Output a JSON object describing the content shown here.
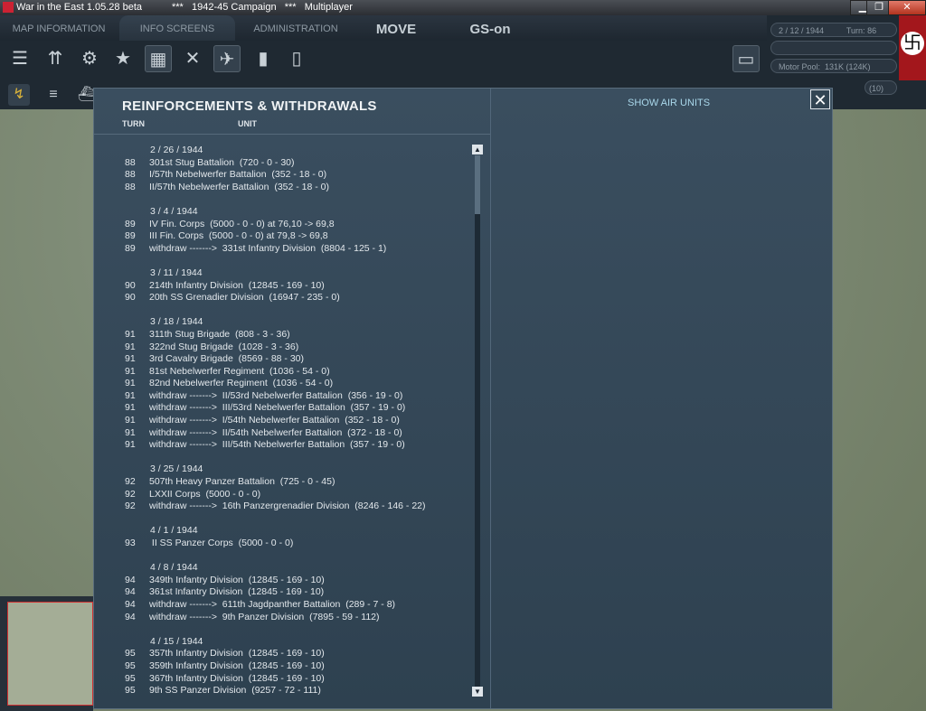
{
  "window": {
    "title": "War in the East 1.05.28 beta",
    "campaign": "***   1942-45 Campaign   ***   Multiplayer",
    "minimize": "▁",
    "restore": "❐",
    "close": "✕"
  },
  "tabs": {
    "map_information": "MAP INFORMATION",
    "info_screens": "INFO SCREENS",
    "administration": "ADMINISTRATION",
    "move": "MOVE",
    "gs_on": "GS-on"
  },
  "status": {
    "date": "2 / 12 / 1944",
    "turn": "Turn: 86",
    "motor_pool": "Motor Pool:  131K (124K)",
    "counter": "(10)"
  },
  "dialog": {
    "title": "REINFORCEMENTS & WITHDRAWALS",
    "col_turn": "TURN",
    "col_unit": "UNIT",
    "show_air_units": "SHOW AIR UNITS",
    "close": "✕",
    "scroll_up": "▲",
    "scroll_down": "▼"
  },
  "entries": [
    {
      "type": "date",
      "text": "2 / 26 / 1944"
    },
    {
      "type": "item",
      "turn": "88",
      "unit": "301st Stug Battalion  (720 - 0 - 30)"
    },
    {
      "type": "item",
      "turn": "88",
      "unit": "I/57th Nebelwerfer Battalion  (352 - 18 - 0)"
    },
    {
      "type": "item",
      "turn": "88",
      "unit": "II/57th Nebelwerfer Battalion  (352 - 18 - 0)"
    },
    {
      "type": "gap"
    },
    {
      "type": "date",
      "text": "3 / 4 / 1944"
    },
    {
      "type": "item",
      "turn": "89",
      "unit": "IV Fin. Corps  (5000 - 0 - 0) at 76,10 -> 69,8"
    },
    {
      "type": "item",
      "turn": "89",
      "unit": "III Fin. Corps  (5000 - 0 - 0) at 79,8 -> 69,8"
    },
    {
      "type": "item",
      "turn": "89",
      "unit": "withdraw ------->  331st Infantry Division  (8804 - 125 - 1)"
    },
    {
      "type": "gap"
    },
    {
      "type": "date",
      "text": "3 / 11 / 1944"
    },
    {
      "type": "item",
      "turn": "90",
      "unit": "214th Infantry Division  (12845 - 169 - 10)"
    },
    {
      "type": "item",
      "turn": "90",
      "unit": "20th SS Grenadier Division  (16947 - 235 - 0)"
    },
    {
      "type": "gap"
    },
    {
      "type": "date",
      "text": "3 / 18 / 1944"
    },
    {
      "type": "item",
      "turn": "91",
      "unit": "311th Stug Brigade  (808 - 3 - 36)"
    },
    {
      "type": "item",
      "turn": "91",
      "unit": "322nd Stug Brigade  (1028 - 3 - 36)"
    },
    {
      "type": "item",
      "turn": "91",
      "unit": "3rd Cavalry Brigade  (8569 - 88 - 30)"
    },
    {
      "type": "item",
      "turn": "91",
      "unit": "81st Nebelwerfer Regiment  (1036 - 54 - 0)"
    },
    {
      "type": "item",
      "turn": "91",
      "unit": "82nd Nebelwerfer Regiment  (1036 - 54 - 0)"
    },
    {
      "type": "item",
      "turn": "91",
      "unit": "withdraw ------->  II/53rd Nebelwerfer Battalion  (356 - 19 - 0)"
    },
    {
      "type": "item",
      "turn": "91",
      "unit": "withdraw ------->  III/53rd Nebelwerfer Battalion  (357 - 19 - 0)"
    },
    {
      "type": "item",
      "turn": "91",
      "unit": "withdraw ------->  I/54th Nebelwerfer Battalion  (352 - 18 - 0)"
    },
    {
      "type": "item",
      "turn": "91",
      "unit": "withdraw ------->  II/54th Nebelwerfer Battalion  (372 - 18 - 0)"
    },
    {
      "type": "item",
      "turn": "91",
      "unit": "withdraw ------->  III/54th Nebelwerfer Battalion  (357 - 19 - 0)"
    },
    {
      "type": "gap"
    },
    {
      "type": "date",
      "text": "3 / 25 / 1944"
    },
    {
      "type": "item",
      "turn": "92",
      "unit": "507th Heavy Panzer Battalion  (725 - 0 - 45)"
    },
    {
      "type": "item",
      "turn": "92",
      "unit": "LXXII Corps  (5000 - 0 - 0)"
    },
    {
      "type": "item",
      "turn": "92",
      "unit": "withdraw ------->  16th Panzergrenadier Division  (8246 - 146 - 22)"
    },
    {
      "type": "gap"
    },
    {
      "type": "date",
      "text": "4 / 1 / 1944"
    },
    {
      "type": "item",
      "turn": "93",
      "unit": " II SS Panzer Corps  (5000 - 0 - 0)"
    },
    {
      "type": "gap"
    },
    {
      "type": "date",
      "text": "4 / 8 / 1944"
    },
    {
      "type": "item",
      "turn": "94",
      "unit": "349th Infantry Division  (12845 - 169 - 10)"
    },
    {
      "type": "item",
      "turn": "94",
      "unit": "361st Infantry Division  (12845 - 169 - 10)"
    },
    {
      "type": "item",
      "turn": "94",
      "unit": "withdraw ------->  611th Jagdpanther Battalion  (289 - 7 - 8)"
    },
    {
      "type": "item",
      "turn": "94",
      "unit": "withdraw ------->  9th Panzer Division  (7895 - 59 - 112)"
    },
    {
      "type": "gap"
    },
    {
      "type": "date",
      "text": "4 / 15 / 1944"
    },
    {
      "type": "item",
      "turn": "95",
      "unit": "357th Infantry Division  (12845 - 169 - 10)"
    },
    {
      "type": "item",
      "turn": "95",
      "unit": "359th Infantry Division  (12845 - 169 - 10)"
    },
    {
      "type": "item",
      "turn": "95",
      "unit": "367th Infantry Division  (12845 - 169 - 10)"
    },
    {
      "type": "item",
      "turn": "95",
      "unit": "9th SS Panzer Division  (9257 - 72 - 111)"
    }
  ],
  "scroll": {
    "position": 0.0,
    "visible_fraction": 0.11
  },
  "colors": {
    "accent": "#a9d7ea",
    "dialog_bg": "#34495a",
    "flag_red": "#a3171c"
  }
}
